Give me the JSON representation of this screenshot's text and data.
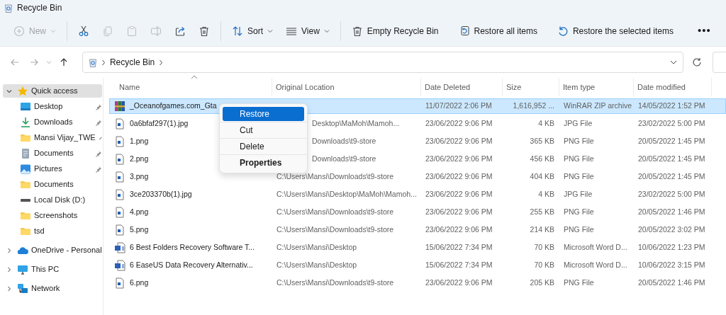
{
  "window": {
    "title": "Recycle Bin"
  },
  "toolbar": [
    {
      "kind": "new",
      "label": "New",
      "disabled": true
    },
    {
      "kind": "separator"
    },
    {
      "kind": "cut",
      "disabled": false
    },
    {
      "kind": "copy",
      "disabled": true
    },
    {
      "kind": "paste",
      "disabled": true
    },
    {
      "kind": "rename",
      "disabled": true
    },
    {
      "kind": "share",
      "disabled": false
    },
    {
      "kind": "delete",
      "disabled": false
    },
    {
      "kind": "separator"
    },
    {
      "kind": "sort",
      "label": "Sort",
      "disabled": false
    },
    {
      "kind": "view",
      "label": "View",
      "disabled": false
    },
    {
      "kind": "separator"
    },
    {
      "kind": "empty",
      "label": "Empty Recycle Bin",
      "disabled": false
    },
    {
      "kind": "restore-all",
      "label": "Restore all items",
      "disabled": false
    },
    {
      "kind": "restore-selected",
      "label": "Restore the selected items",
      "disabled": false
    },
    {
      "kind": "more",
      "label": "•••",
      "disabled": false
    }
  ],
  "navigation": [
    {
      "kind": "back",
      "disabled": true
    },
    {
      "kind": "forward",
      "disabled": true
    },
    {
      "kind": "recent",
      "disabled": true
    },
    {
      "kind": "up",
      "disabled": false
    }
  ],
  "address_bar": {
    "breadcrumbs": [
      "Recycle Bin"
    ]
  },
  "sidebar": {
    "items": [
      {
        "label": "Quick access",
        "kind": "star",
        "selected": true,
        "expanded": true,
        "children": [
          {
            "label": "Desktop",
            "kind": "desktop",
            "pinned": true,
            "selected": false
          },
          {
            "label": "Downloads",
            "kind": "download",
            "pinned": true,
            "selected": false
          },
          {
            "label": "Mansi Vijay_TWE",
            "kind": "folder",
            "pinned": true,
            "selected": false
          },
          {
            "label": "Documents",
            "kind": "documents",
            "pinned": true,
            "selected": false
          },
          {
            "label": "Pictures",
            "kind": "pictures",
            "pinned": true,
            "selected": false
          },
          {
            "label": "Documents",
            "kind": "folder",
            "pinned": false,
            "selected": false
          },
          {
            "label": "Local Disk (D:)",
            "kind": "drive",
            "pinned": false,
            "selected": false
          },
          {
            "label": "Screenshots",
            "kind": "folder",
            "pinned": false,
            "selected": false
          },
          {
            "label": "tsd",
            "kind": "folder",
            "pinned": false,
            "selected": false
          }
        ]
      },
      {
        "label": "OneDrive - Personal",
        "kind": "cloud",
        "selected": false,
        "expanded": false
      },
      {
        "label": "This PC",
        "kind": "pc",
        "selected": false,
        "expanded": false
      },
      {
        "label": "Network",
        "kind": "network",
        "selected": false,
        "expanded": false
      }
    ]
  },
  "table": {
    "columns": [
      {
        "label": "Name",
        "sorted": true
      },
      {
        "label": "Original Location",
        "sorted": false
      },
      {
        "label": "Date Deleted",
        "sorted": false
      },
      {
        "label": "Size",
        "sorted": false
      },
      {
        "label": "Item type",
        "sorted": false
      },
      {
        "label": "Date modified",
        "sorted": false
      }
    ],
    "rows": [
      {
        "kind": "zip",
        "name": "_Oceanofgames.com_Gta",
        "location": "",
        "date_deleted": "11/07/2022 2:06 PM",
        "size": "1,616,952 ...",
        "type": "WinRAR ZIP archive",
        "modified": "14/05/2022 1:52 PM",
        "selected": true
      },
      {
        "kind": "image",
        "name": "0a6bfaf297(1).jpg",
        "location": "Desktop\\MaMoh\\Mamoh...",
        "date_deleted": "23/06/2022 9:06 PM",
        "size": "4 KB",
        "type": "JPG File",
        "modified": "23/02/2022 5:00 PM",
        "selected": false
      },
      {
        "kind": "image",
        "name": "1.png",
        "location": "Downloads\\t9-store",
        "date_deleted": "23/06/2022 9:06 PM",
        "size": "365 KB",
        "type": "PNG File",
        "modified": "20/05/2022 1:45 PM",
        "selected": false
      },
      {
        "kind": "image",
        "name": "2.png",
        "location": "Downloads\\t9-store",
        "date_deleted": "23/06/2022 9:06 PM",
        "size": "456 KB",
        "type": "PNG File",
        "modified": "20/05/2022 1:45 PM",
        "selected": false
      },
      {
        "kind": "image",
        "name": "3.png",
        "location": "C:\\Users\\Mansi\\Downloads\\t9-store",
        "date_deleted": "23/06/2022 9:06 PM",
        "size": "404 KB",
        "type": "PNG File",
        "modified": "20/05/2022 1:45 PM",
        "selected": false
      },
      {
        "kind": "image",
        "name": "3ce203370b(1).jpg",
        "location": "C:\\Users\\Mansi\\Desktop\\MaMoh\\Mamoh...",
        "date_deleted": "23/06/2022 9:06 PM",
        "size": "4 KB",
        "type": "JPG File",
        "modified": "23/02/2022 5:00 PM",
        "selected": false
      },
      {
        "kind": "image",
        "name": "4.png",
        "location": "C:\\Users\\Mansi\\Downloads\\t9-store",
        "date_deleted": "23/06/2022 9:06 PM",
        "size": "255 KB",
        "type": "PNG File",
        "modified": "20/05/2022 1:46 PM",
        "selected": false
      },
      {
        "kind": "image",
        "name": "5.png",
        "location": "C:\\Users\\Mansi\\Downloads\\t9-store",
        "date_deleted": "23/06/2022 9:06 PM",
        "size": "214 KB",
        "type": "PNG File",
        "modified": "20/05/2022 3:02 PM",
        "selected": false
      },
      {
        "kind": "word",
        "name": "6 Best Folders Recovery Software T...",
        "location": "C:\\Users\\Mansi\\Desktop",
        "date_deleted": "15/06/2022 7:34 PM",
        "size": "70 KB",
        "type": "Microsoft Word D...",
        "modified": "10/06/2022 1:23 PM",
        "selected": false
      },
      {
        "kind": "word",
        "name": "6 EaseUS Data Recovery Alternativ...",
        "location": "C:\\Users\\Mansi\\Desktop",
        "date_deleted": "15/06/2022 7:34 PM",
        "size": "70 KB",
        "type": "Microsoft Word D...",
        "modified": "10/06/2022 3:15 PM",
        "selected": false
      },
      {
        "kind": "image",
        "name": "6.png",
        "location": "C:\\Users\\Mansi\\Downloads\\t9-store",
        "date_deleted": "23/06/2022 9:06 PM",
        "size": "205 KB",
        "type": "PNG File",
        "modified": "20/05/2022 1:46 PM",
        "selected": false
      }
    ]
  },
  "context_menu": {
    "items": [
      {
        "label": "Restore",
        "selected": true,
        "default": false
      },
      {
        "label": "Cut",
        "selected": false,
        "default": false
      },
      {
        "label": "Delete",
        "selected": false,
        "default": false
      },
      {
        "label": "Properties",
        "selected": false,
        "default": true
      }
    ]
  }
}
